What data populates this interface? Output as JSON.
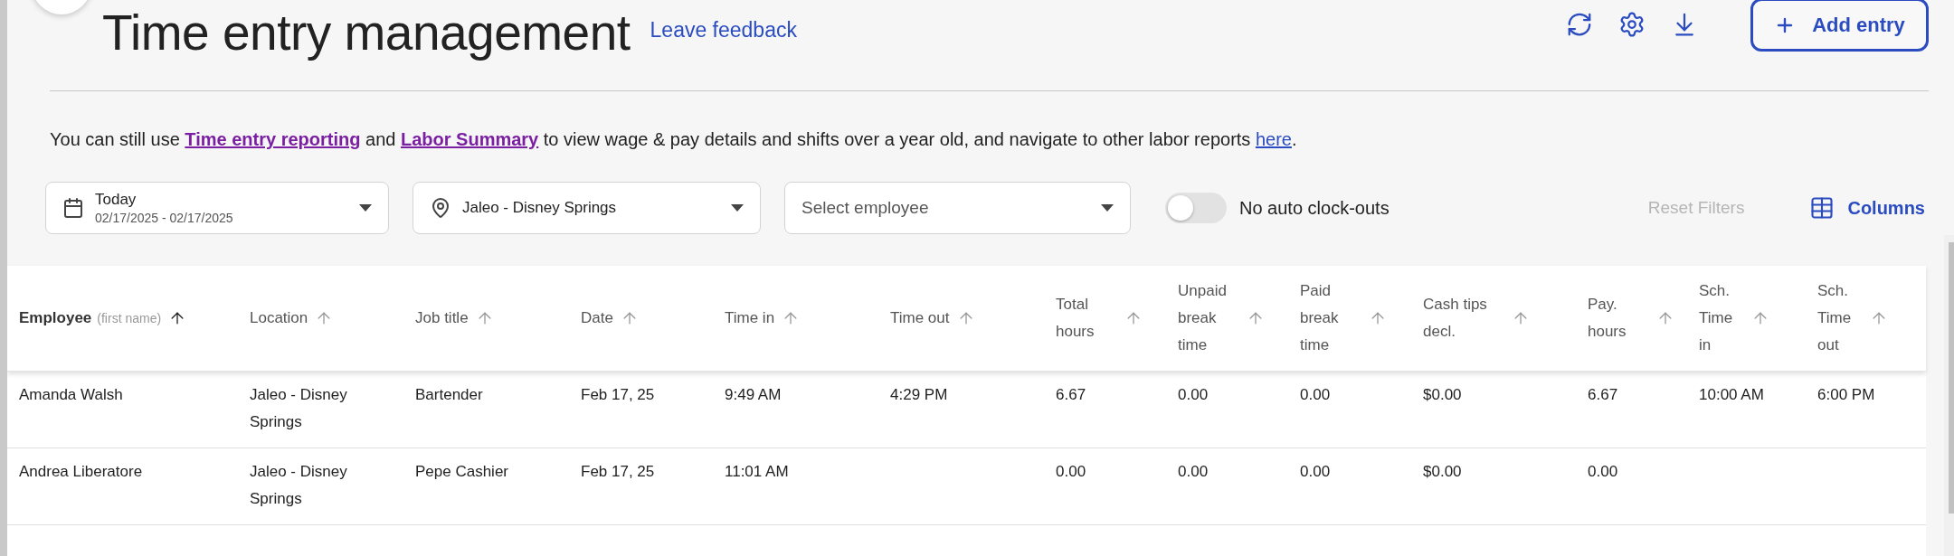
{
  "header": {
    "title": "Time entry management",
    "feedback_link": "Leave feedback",
    "add_button": "Add entry"
  },
  "notice": {
    "parts": [
      {
        "kind": "text",
        "text": "You can still use "
      },
      {
        "kind": "link",
        "text": "Time entry reporting",
        "visited": true
      },
      {
        "kind": "text",
        "text": " and "
      },
      {
        "kind": "link",
        "text": "Labor Summary",
        "visited": true
      },
      {
        "kind": "text",
        "text": " to view wage & pay details and shifts over a year old, and navigate to other labor reports "
      },
      {
        "kind": "link",
        "text": "here",
        "visited": false
      },
      {
        "kind": "text",
        "text": "."
      }
    ]
  },
  "filters": {
    "date": {
      "label": "Today",
      "range": "02/17/2025 - 02/17/2025"
    },
    "location": {
      "value": "Jaleo - Disney Springs"
    },
    "employee": {
      "placeholder": "Select employee"
    },
    "toggle": {
      "label": "No auto clock-outs",
      "on": false
    },
    "reset": {
      "label": "Reset Filters",
      "disabled": true
    },
    "columns_button": "Columns"
  },
  "table": {
    "columns": [
      {
        "label": "Employee",
        "hint": "(first name)",
        "sorted": true
      },
      {
        "label": "Location",
        "sorted": false
      },
      {
        "label": "Job title",
        "sorted": false
      },
      {
        "label": "Date",
        "sorted": false
      },
      {
        "label": "Time in",
        "sorted": false
      },
      {
        "label": "Time out",
        "sorted": false
      },
      {
        "label": "Total hours",
        "sorted": false
      },
      {
        "label": "Unpaid break time",
        "sorted": false
      },
      {
        "label": "Paid break time",
        "sorted": false
      },
      {
        "label": "Cash tips decl.",
        "sorted": false
      },
      {
        "label": "Pay. hours",
        "sorted": false
      },
      {
        "label": "Sch. Time in",
        "sorted": false
      },
      {
        "label": "Sch. Time out",
        "sorted": false
      }
    ],
    "rows": [
      [
        "Amanda Walsh",
        "Jaleo - Disney Springs",
        "Bartender",
        "Feb 17, 25",
        "9:49 AM",
        "4:29 PM",
        "6.67",
        "0.00",
        "0.00",
        "$0.00",
        "6.67",
        "10:00 AM",
        "6:00 PM"
      ],
      [
        "Andrea Liberatore",
        "Jaleo - Disney Springs",
        "Pepe Cashier",
        "Feb 17, 25",
        "11:01 AM",
        "",
        "0.00",
        "0.00",
        "0.00",
        "$0.00",
        "0.00",
        "",
        ""
      ]
    ]
  }
}
